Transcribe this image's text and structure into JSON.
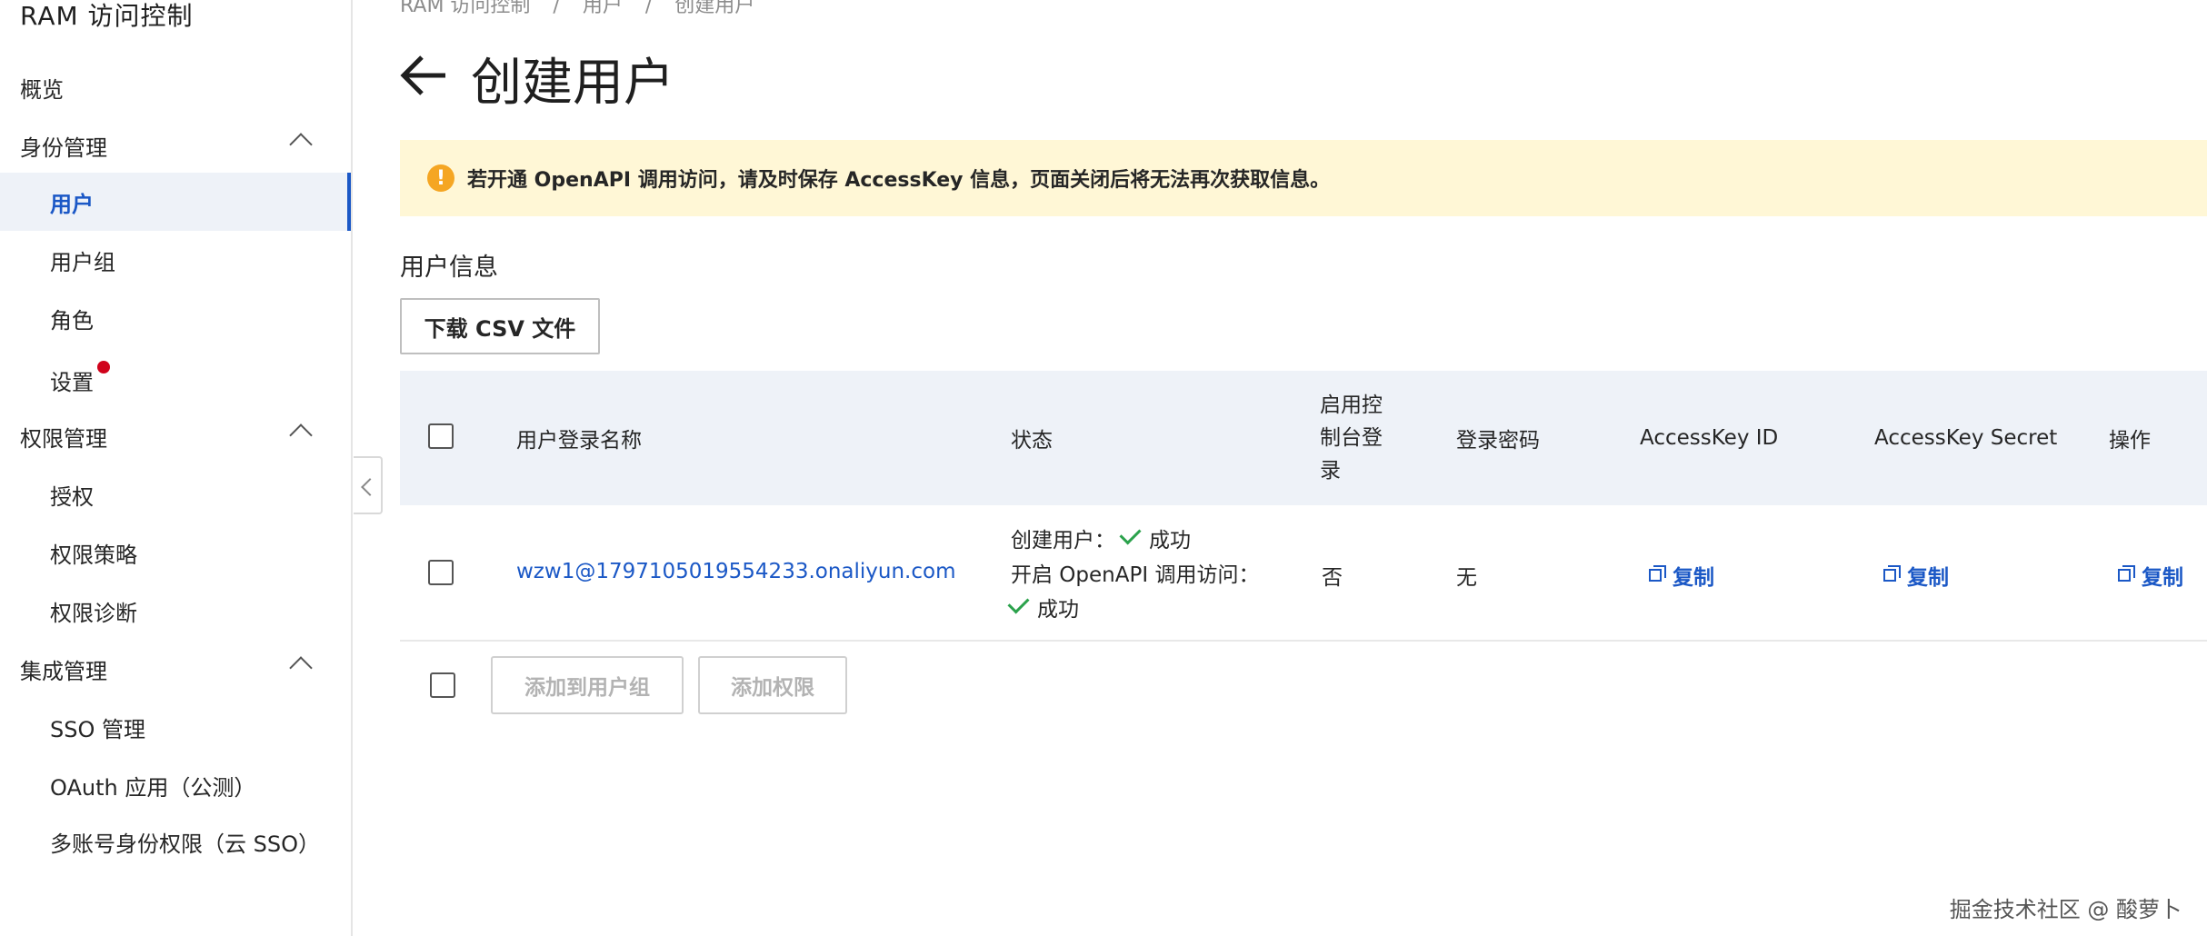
{
  "sidebar": {
    "title": "RAM 访问控制",
    "items": [
      {
        "label": "概览"
      },
      {
        "label": "身份管理"
      },
      {
        "label": "用户"
      },
      {
        "label": "用户组"
      },
      {
        "label": "角色"
      },
      {
        "label": "设置"
      },
      {
        "label": "权限管理"
      },
      {
        "label": "授权"
      },
      {
        "label": "权限策略"
      },
      {
        "label": "权限诊断"
      },
      {
        "label": "集成管理"
      },
      {
        "label": "SSO 管理"
      },
      {
        "label": "OAuth 应用（公测）"
      },
      {
        "label": "多账号身份权限（云 SSO）"
      }
    ]
  },
  "breadcrumb": [
    "RAM 访问控制",
    "/",
    "用户",
    "/",
    "创建用户"
  ],
  "page": {
    "title": "创建用户",
    "alert": "若开通 OpenAPI 调用访问，请及时保存 AccessKey 信息，页面关闭后将无法再次获取信息。",
    "section_title": "用户信息",
    "csv_button": "下载 CSV 文件"
  },
  "table": {
    "headers": {
      "login_name": "用户登录名称",
      "status": "状态",
      "console_login": "启用控制台登录",
      "password": "登录密码",
      "ak_id": "AccessKey ID",
      "ak_secret": "AccessKey Secret",
      "actions": "操作"
    },
    "row": {
      "login_name": "wzw1@1797105019554233.onaliyun.com",
      "status_line1_label": "创建用户：",
      "status_line1_value": "成功",
      "status_line2_label": "开启 OpenAPI 调用访问：",
      "status_line2_value": "成功",
      "console_login": "否",
      "password": "无",
      "ak_id_copy": "复制",
      "ak_secret_copy": "复制",
      "action_copy": "复制"
    }
  },
  "footer": {
    "add_to_group": "添加到用户组",
    "add_permission": "添加权限"
  },
  "watermark": "掘金技术社区 @ 酸萝卜",
  "colors": {
    "accent": "#1b58c6",
    "alert_bg": "#fff7d6",
    "warning": "#f5a623",
    "success": "#2ba24c",
    "header_bg": "#eef2f8"
  }
}
